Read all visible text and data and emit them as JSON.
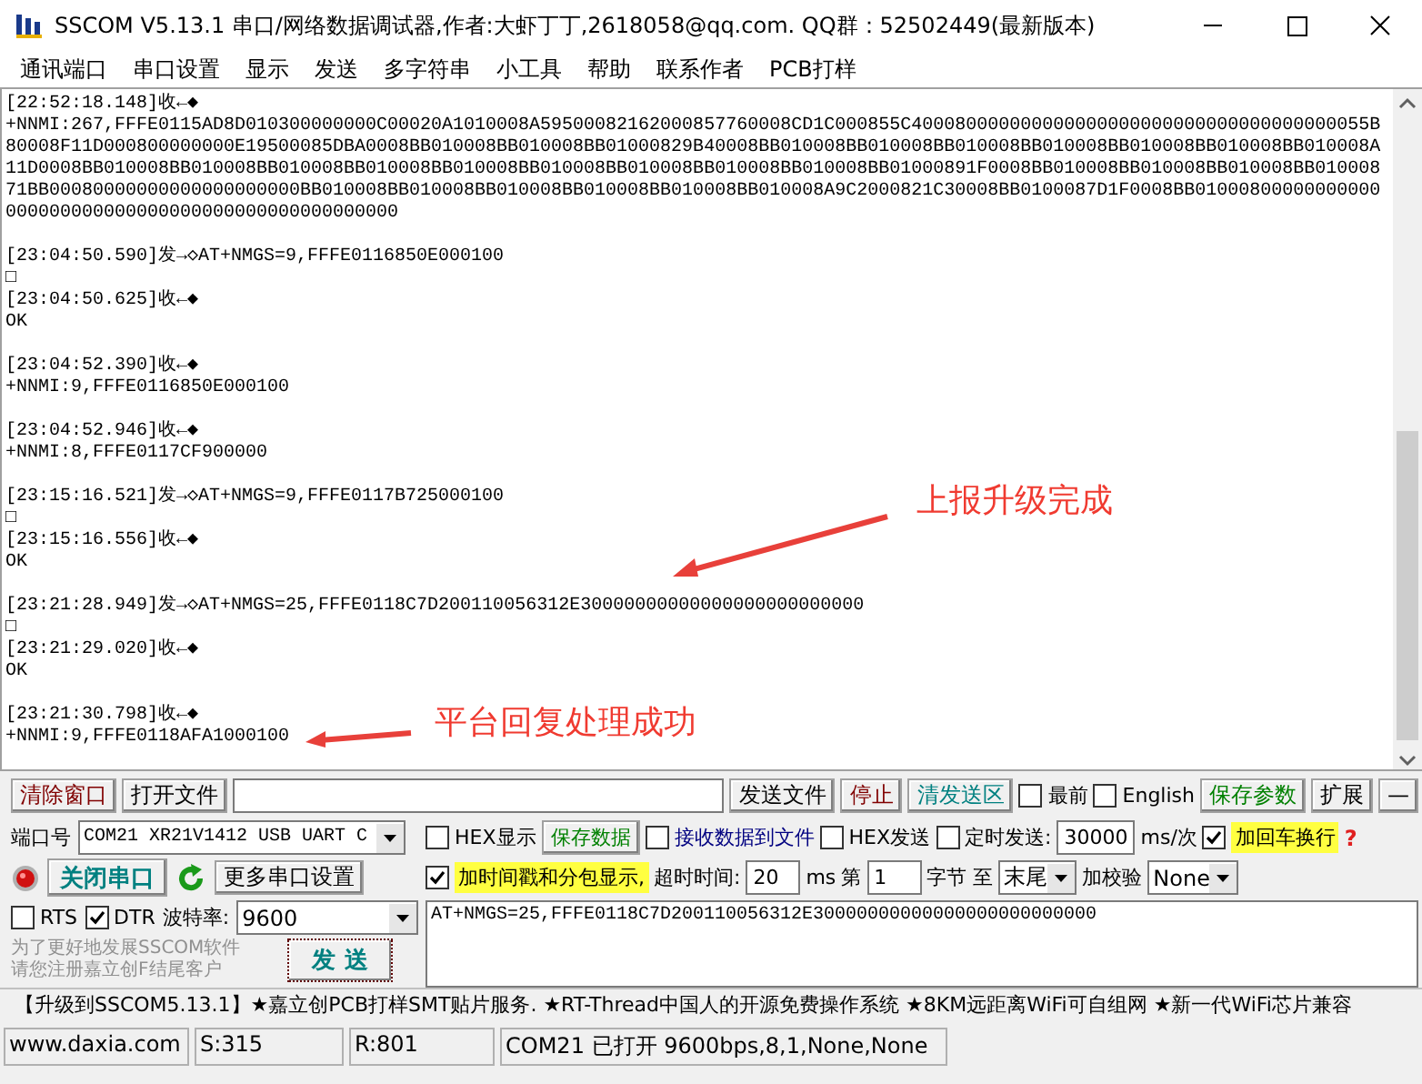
{
  "window": {
    "title": "SSCOM V5.13.1 串口/网络数据调试器,作者:大虾丁丁,2618058@qq.com. QQ群：52502449(最新版本)"
  },
  "menu": [
    "通讯端口",
    "串口设置",
    "显示",
    "发送",
    "多字符串",
    "小工具",
    "帮助",
    "联系作者",
    "PCB打样"
  ],
  "log": {
    "blocks": [
      {
        "lines": [
          "[22:52:18.148]收←◆",
          "+NNMI:267,FFFE0115AD8D010300000000C00020A1010008A59500082162000857760008CD1C000855C400080000000000000000000000000000000000055B80008F11D000800000000E19500085DBA0008BB010008BB010008BB01000829B40008BB010008BB010008BB010008BB010008BB010008BB010008BB010008A11D0008BB010008BB010008BB010008BB010008BB010008BB010008BB010008BB010008BB010008BB01000891F0008BB010008BB010008BB010008BB01000871BB00080000000000000000000BB010008BB010008BB010008BB010008BB010008BB010008A9C2000821C30008BB0100087D1F0008BB01000800000000000000000000000000000000000000000000000"
        ]
      },
      {
        "lines": [
          "[23:04:50.590]发→◇AT+NMGS=9,FFFE0116850E000100",
          "□",
          "[23:04:50.625]收←◆",
          "OK"
        ]
      },
      {
        "lines": [
          "[23:04:52.390]收←◆",
          "+NNMI:9,FFFE0116850E000100"
        ]
      },
      {
        "lines": [
          "[23:04:52.946]收←◆",
          "+NNMI:8,FFFE0117CF900000"
        ]
      },
      {
        "lines": [
          "[23:15:16.521]发→◇AT+NMGS=9,FFFE0117B725000100",
          "□",
          "[23:15:16.556]收←◆",
          "OK"
        ]
      },
      {
        "lines": [
          "[23:21:28.949]发→◇AT+NMGS=25,FFFE0118C7D200110056312E30000000000000000000000000",
          "□",
          "[23:21:29.020]收←◆",
          "OK"
        ]
      },
      {
        "lines": [
          "[23:21:30.798]收←◆",
          "+NNMI:9,FFFE0118AFA1000100"
        ]
      }
    ]
  },
  "annotations": [
    {
      "kind": "upgrade",
      "text": "上报升级完成"
    },
    {
      "kind": "reply",
      "text": "平台回复处理成功"
    }
  ],
  "toolbar": [
    {
      "kind": "button",
      "label": "清除窗口",
      "color": "#800000"
    },
    {
      "kind": "button",
      "label": "打开文件",
      "color": "#000000"
    },
    {
      "kind": "field"
    },
    {
      "kind": "button",
      "label": "发送文件",
      "color": "#000000"
    },
    {
      "kind": "button",
      "label": "停止",
      "color": "#800000"
    },
    {
      "kind": "button",
      "label": "清发送区",
      "color": "#008080"
    },
    {
      "kind": "checkbox",
      "label": "最前",
      "checked": false
    },
    {
      "kind": "checkbox",
      "label": "English",
      "checked": false
    },
    {
      "kind": "button",
      "label": "保存参数",
      "color": "#008000"
    },
    {
      "kind": "button",
      "label": "扩展",
      "color": "#000000"
    },
    {
      "kind": "button",
      "label": "—",
      "color": "#000000"
    }
  ],
  "port": {
    "label": "端口号",
    "value": "COM21 XR21V1412 USB UART C"
  },
  "port_button": {
    "label": "关闭串口"
  },
  "more_settings": {
    "label": "更多串口设置"
  },
  "rts": {
    "label": "RTS",
    "checked": false
  },
  "dtr": {
    "label": "DTR",
    "checked": true
  },
  "baud": {
    "label": "波特率:",
    "value": "9600"
  },
  "promo": [
    "为了更好地发展SSCOM软件",
    "请您注册嘉立创F结尾客户"
  ],
  "send_button": {
    "label": "发 送"
  },
  "options": [
    [
      {
        "kind": "checkbox",
        "label": "HEX显示",
        "checked": false
      },
      {
        "kind": "button",
        "label": "保存数据",
        "color": "#008000"
      },
      {
        "kind": "checkbox",
        "label": "接收数据到文件",
        "checked": false,
        "color": "#000080"
      },
      {
        "kind": "checkbox",
        "label": "HEX发送",
        "checked": false
      },
      {
        "kind": "checkbox",
        "label": "定时发送:",
        "checked": false
      },
      {
        "kind": "field",
        "value": "30000"
      },
      {
        "kind": "text",
        "label": "ms/次"
      },
      {
        "kind": "checkbox",
        "label": "加回车换行",
        "checked": true,
        "highlight": true
      },
      {
        "kind": "help",
        "label": "?"
      }
    ],
    [
      {
        "kind": "checkbox",
        "label": "加时间戳和分包显示,",
        "checked": true,
        "highlight": true
      },
      {
        "kind": "text",
        "label": "超时时间:"
      },
      {
        "kind": "field",
        "value": "20"
      },
      {
        "kind": "text",
        "label": "ms"
      },
      {
        "kind": "text",
        "label": "第"
      },
      {
        "kind": "field",
        "value": "1"
      },
      {
        "kind": "text",
        "label": "字节 至"
      },
      {
        "kind": "select",
        "value": "末尾"
      },
      {
        "kind": "text",
        "label": "加校验"
      },
      {
        "kind": "select",
        "value": "None"
      }
    ]
  ],
  "send_text": {
    "value": "AT+NMGS=25,FFFE0118C7D200110056312E30000000000000000000000000"
  },
  "ticker": "【升级到SSCOM5.13.1】★嘉立创PCB打样SMT贴片服务. ★RT-Thread中国人的开源免费操作系统 ★8KM远距离WiFi可自组网 ★新一代WiFi芯片兼容",
  "status_bar": [
    "www.daxia.com",
    "S:315",
    "R:801",
    "COM21 已打开  9600bps,8,1,None,None"
  ]
}
